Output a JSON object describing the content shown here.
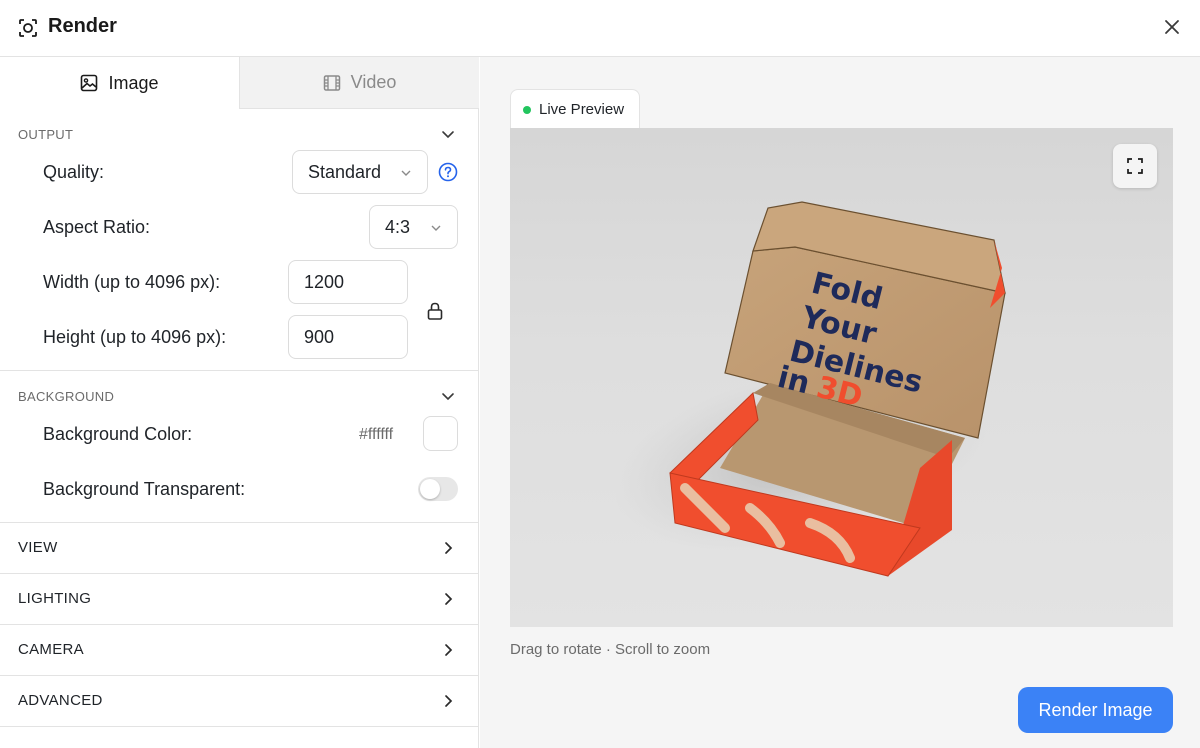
{
  "header": {
    "title": "Render",
    "logo_icon": "render-focus-icon",
    "close_icon": "close-icon"
  },
  "tabs": [
    {
      "label": "Image",
      "icon": "image-icon",
      "active": true
    },
    {
      "label": "Video",
      "icon": "film-icon",
      "active": false
    }
  ],
  "output": {
    "section_label": "OUTPUT",
    "quality_label": "Quality:",
    "quality_value": "Standard",
    "aspect_label": "Aspect Ratio:",
    "aspect_value": "4:3",
    "width_label": "Width (up to 4096 px):",
    "width_value": "1200",
    "height_label": "Height (up to 4096 px):",
    "height_value": "900"
  },
  "background": {
    "section_label": "BACKGROUND",
    "color_label": "Background Color:",
    "color_value": "#ffffff",
    "transparent_label": "Background Transparent:",
    "transparent_on": false
  },
  "collapsed_sections": [
    {
      "label": "VIEW"
    },
    {
      "label": "LIGHTING"
    },
    {
      "label": "CAMERA"
    },
    {
      "label": "ADVANCED"
    }
  ],
  "preview": {
    "tab_label": "Live Preview",
    "box_text": [
      "Fold",
      "Your",
      "Dielines",
      "in"
    ],
    "box_accent_text": "3D",
    "hint": "Drag to rotate · Scroll to zoom"
  },
  "actions": {
    "render_label": "Render Image"
  },
  "colors": {
    "accent": "#3b82f6",
    "live_dot": "#22c55e",
    "box_orange": "#f04e2e",
    "box_kraft": "#c9a47a"
  }
}
